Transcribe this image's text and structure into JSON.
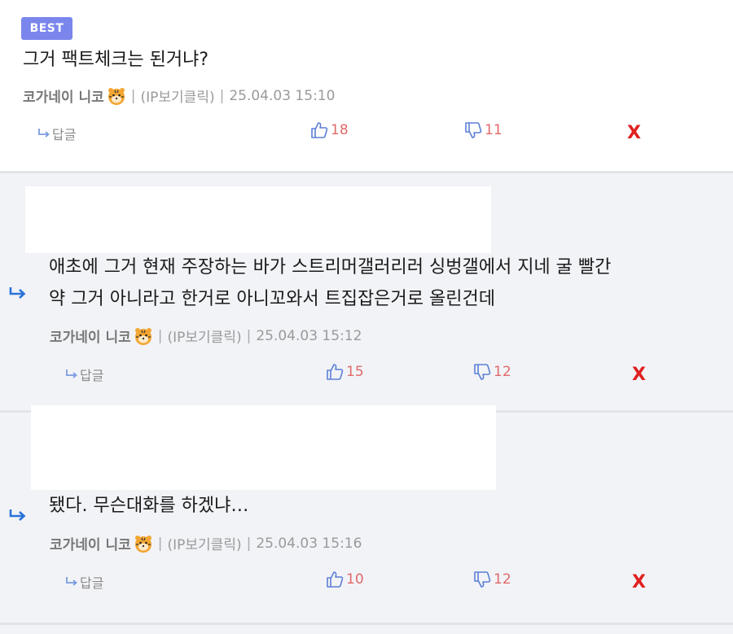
{
  "best_comment": {
    "badge": "BEST",
    "text": "그거 팩트체크는 된거냐?",
    "author": "코가네이 니코",
    "ip_label": "(IP보기클릭)",
    "datetime": "25.04.03 15:10",
    "reply_label": "답글",
    "likes": "18",
    "dislikes": "11",
    "delete_label": "X"
  },
  "replies": [
    {
      "lines": [
        "애초에 그거 현재 주장하는 바가 스트리머갤러리러 싱벙갤에서 지네 굴 빨간",
        "약 그거 아니라고 한거로 아니꼬와서 트집잡은거로 올린건데"
      ],
      "author": "코가네이 니코",
      "ip_label": "(IP보기클릭)",
      "datetime": "25.04.03 15:12",
      "reply_label": "답글",
      "likes": "15",
      "dislikes": "12",
      "delete_label": "X"
    },
    {
      "lines": [
        "됐다. 무슨대화를 하겠냐…"
      ],
      "author": "코가네이 니코",
      "ip_label": "(IP보기클릭)",
      "datetime": "25.04.03 15:16",
      "reply_label": "답글",
      "likes": "10",
      "dislikes": "12",
      "delete_label": "X"
    }
  ],
  "icons": {
    "reply": "reply-arrow-icon",
    "like": "thumbs-up-icon",
    "dislike": "thumbs-down-icon",
    "nested": "nested-reply-arrow-icon",
    "avatar": "tiger-emoji-icon"
  },
  "colors": {
    "badge": "#7a86ec",
    "vote": "#e06a6a",
    "delete": "#e02020",
    "reply_bg": "#f2f3f7",
    "thumb_icon": "#5b7fd6",
    "nested_arrow": "#2a73d9"
  }
}
